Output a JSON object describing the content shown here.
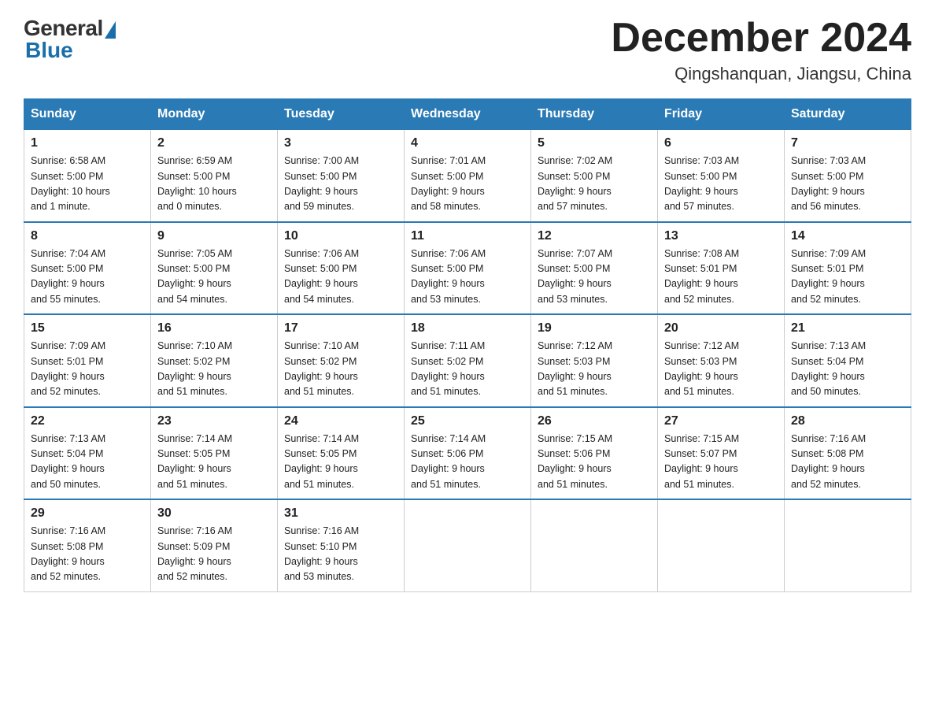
{
  "logo": {
    "general": "General",
    "blue": "Blue"
  },
  "title": "December 2024",
  "subtitle": "Qingshanquan, Jiangsu, China",
  "days_of_week": [
    "Sunday",
    "Monday",
    "Tuesday",
    "Wednesday",
    "Thursday",
    "Friday",
    "Saturday"
  ],
  "weeks": [
    [
      {
        "day": "1",
        "info": "Sunrise: 6:58 AM\nSunset: 5:00 PM\nDaylight: 10 hours\nand 1 minute."
      },
      {
        "day": "2",
        "info": "Sunrise: 6:59 AM\nSunset: 5:00 PM\nDaylight: 10 hours\nand 0 minutes."
      },
      {
        "day": "3",
        "info": "Sunrise: 7:00 AM\nSunset: 5:00 PM\nDaylight: 9 hours\nand 59 minutes."
      },
      {
        "day": "4",
        "info": "Sunrise: 7:01 AM\nSunset: 5:00 PM\nDaylight: 9 hours\nand 58 minutes."
      },
      {
        "day": "5",
        "info": "Sunrise: 7:02 AM\nSunset: 5:00 PM\nDaylight: 9 hours\nand 57 minutes."
      },
      {
        "day": "6",
        "info": "Sunrise: 7:03 AM\nSunset: 5:00 PM\nDaylight: 9 hours\nand 57 minutes."
      },
      {
        "day": "7",
        "info": "Sunrise: 7:03 AM\nSunset: 5:00 PM\nDaylight: 9 hours\nand 56 minutes."
      }
    ],
    [
      {
        "day": "8",
        "info": "Sunrise: 7:04 AM\nSunset: 5:00 PM\nDaylight: 9 hours\nand 55 minutes."
      },
      {
        "day": "9",
        "info": "Sunrise: 7:05 AM\nSunset: 5:00 PM\nDaylight: 9 hours\nand 54 minutes."
      },
      {
        "day": "10",
        "info": "Sunrise: 7:06 AM\nSunset: 5:00 PM\nDaylight: 9 hours\nand 54 minutes."
      },
      {
        "day": "11",
        "info": "Sunrise: 7:06 AM\nSunset: 5:00 PM\nDaylight: 9 hours\nand 53 minutes."
      },
      {
        "day": "12",
        "info": "Sunrise: 7:07 AM\nSunset: 5:00 PM\nDaylight: 9 hours\nand 53 minutes."
      },
      {
        "day": "13",
        "info": "Sunrise: 7:08 AM\nSunset: 5:01 PM\nDaylight: 9 hours\nand 52 minutes."
      },
      {
        "day": "14",
        "info": "Sunrise: 7:09 AM\nSunset: 5:01 PM\nDaylight: 9 hours\nand 52 minutes."
      }
    ],
    [
      {
        "day": "15",
        "info": "Sunrise: 7:09 AM\nSunset: 5:01 PM\nDaylight: 9 hours\nand 52 minutes."
      },
      {
        "day": "16",
        "info": "Sunrise: 7:10 AM\nSunset: 5:02 PM\nDaylight: 9 hours\nand 51 minutes."
      },
      {
        "day": "17",
        "info": "Sunrise: 7:10 AM\nSunset: 5:02 PM\nDaylight: 9 hours\nand 51 minutes."
      },
      {
        "day": "18",
        "info": "Sunrise: 7:11 AM\nSunset: 5:02 PM\nDaylight: 9 hours\nand 51 minutes."
      },
      {
        "day": "19",
        "info": "Sunrise: 7:12 AM\nSunset: 5:03 PM\nDaylight: 9 hours\nand 51 minutes."
      },
      {
        "day": "20",
        "info": "Sunrise: 7:12 AM\nSunset: 5:03 PM\nDaylight: 9 hours\nand 51 minutes."
      },
      {
        "day": "21",
        "info": "Sunrise: 7:13 AM\nSunset: 5:04 PM\nDaylight: 9 hours\nand 50 minutes."
      }
    ],
    [
      {
        "day": "22",
        "info": "Sunrise: 7:13 AM\nSunset: 5:04 PM\nDaylight: 9 hours\nand 50 minutes."
      },
      {
        "day": "23",
        "info": "Sunrise: 7:14 AM\nSunset: 5:05 PM\nDaylight: 9 hours\nand 51 minutes."
      },
      {
        "day": "24",
        "info": "Sunrise: 7:14 AM\nSunset: 5:05 PM\nDaylight: 9 hours\nand 51 minutes."
      },
      {
        "day": "25",
        "info": "Sunrise: 7:14 AM\nSunset: 5:06 PM\nDaylight: 9 hours\nand 51 minutes."
      },
      {
        "day": "26",
        "info": "Sunrise: 7:15 AM\nSunset: 5:06 PM\nDaylight: 9 hours\nand 51 minutes."
      },
      {
        "day": "27",
        "info": "Sunrise: 7:15 AM\nSunset: 5:07 PM\nDaylight: 9 hours\nand 51 minutes."
      },
      {
        "day": "28",
        "info": "Sunrise: 7:16 AM\nSunset: 5:08 PM\nDaylight: 9 hours\nand 52 minutes."
      }
    ],
    [
      {
        "day": "29",
        "info": "Sunrise: 7:16 AM\nSunset: 5:08 PM\nDaylight: 9 hours\nand 52 minutes."
      },
      {
        "day": "30",
        "info": "Sunrise: 7:16 AM\nSunset: 5:09 PM\nDaylight: 9 hours\nand 52 minutes."
      },
      {
        "day": "31",
        "info": "Sunrise: 7:16 AM\nSunset: 5:10 PM\nDaylight: 9 hours\nand 53 minutes."
      },
      {
        "day": "",
        "info": ""
      },
      {
        "day": "",
        "info": ""
      },
      {
        "day": "",
        "info": ""
      },
      {
        "day": "",
        "info": ""
      }
    ]
  ]
}
